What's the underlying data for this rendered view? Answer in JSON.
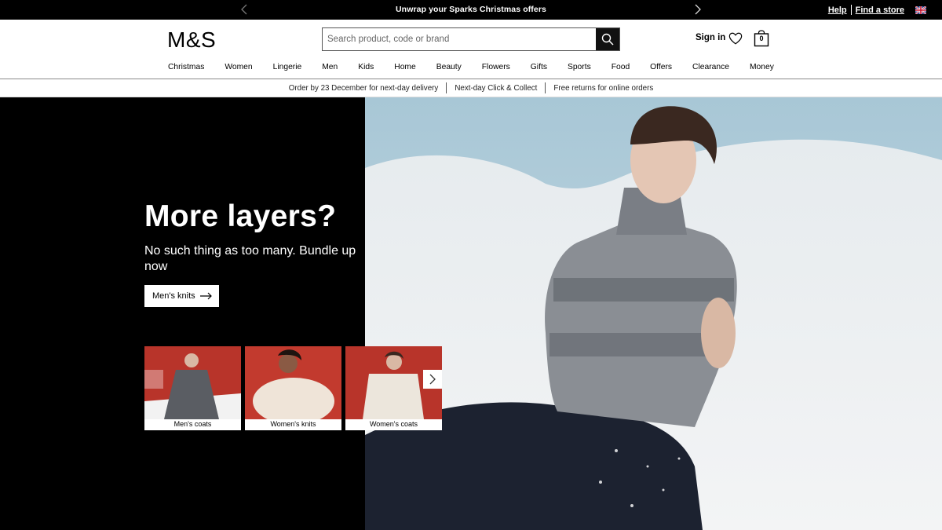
{
  "topbar": {
    "promo": "Unwrap your Sparks Christmas offers",
    "links": {
      "help": "Help",
      "find_store": "Find a store"
    },
    "icons": {
      "prev": "chevron-left-icon",
      "next": "chevron-right-icon",
      "flag": "uk-flag-icon"
    }
  },
  "header": {
    "logo": "M&S",
    "search": {
      "placeholder": "Search product, code or brand",
      "value": ""
    },
    "sign_in": "Sign in",
    "bag_count": "0"
  },
  "nav": [
    "Christmas",
    "Women",
    "Lingerie",
    "Men",
    "Kids",
    "Home",
    "Beauty",
    "Flowers",
    "Gifts",
    "Sports",
    "Food",
    "Offers",
    "Clearance",
    "Money"
  ],
  "usp": [
    "Order by 23 December for next-day delivery",
    "Next-day Click & Collect",
    "Free returns for online orders"
  ],
  "hero": {
    "title": "More layers?",
    "subtitle": "No such thing as too many. Bundle up now",
    "cta": "Men's knits",
    "cards": [
      {
        "label": "Men's coats"
      },
      {
        "label": "Women's knits"
      },
      {
        "label": "Women's coats"
      }
    ]
  },
  "colors": {
    "black": "#000000",
    "white": "#ffffff",
    "sky": "#a9c6d4",
    "snow": "#eef1f3",
    "card_bg": "#b8342a"
  }
}
